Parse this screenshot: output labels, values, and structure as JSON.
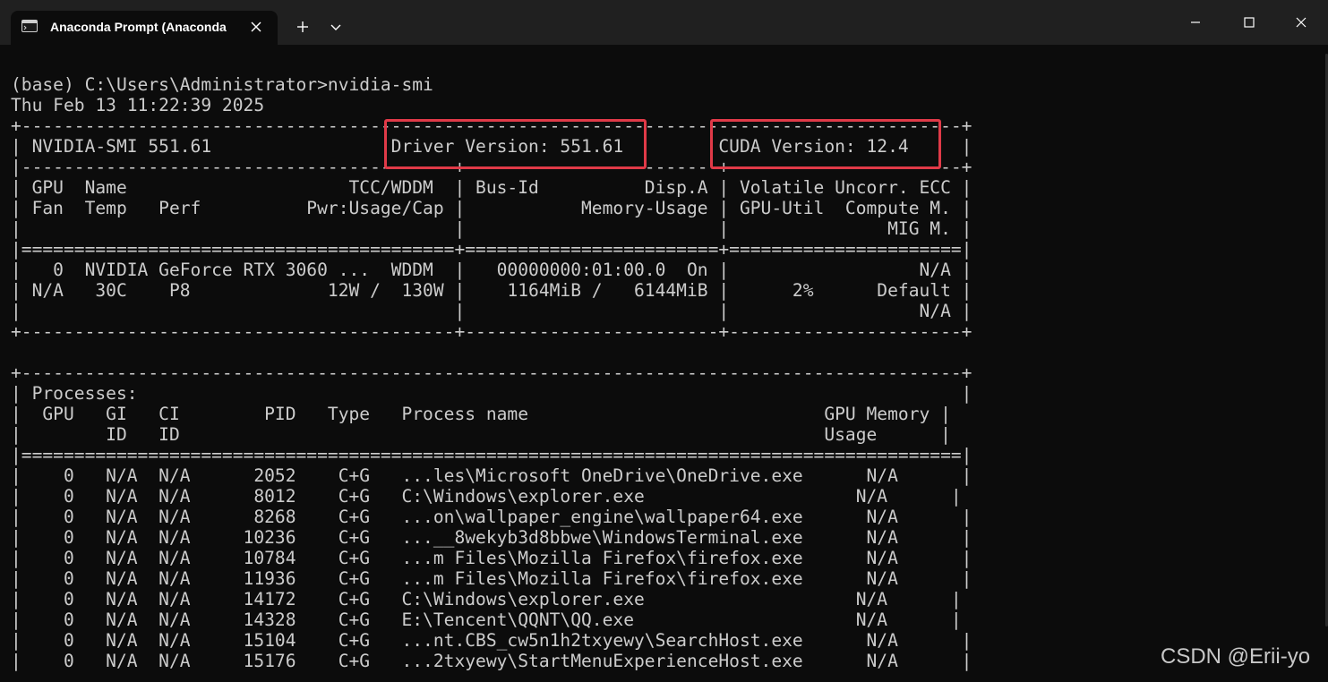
{
  "window": {
    "tab_title": "Anaconda Prompt (Anaconda",
    "tab_icon": "terminal-icon",
    "controls": [
      "minimize",
      "maximize",
      "close"
    ]
  },
  "colors": {
    "background": "#0c0c0c",
    "titlebar": "#202020",
    "text": "#cccccc",
    "highlight": "#e03a48"
  },
  "terminal": {
    "lines": [
      "(base) C:\\Users\\Administrator>nvidia-smi",
      "Thu Feb 13 11:22:39 2025",
      "+-----------------------------------------------------------------------------------------+",
      "| NVIDIA-SMI 551.61                 Driver Version: 551.61         CUDA Version: 12.4     |",
      "|-----------------------------------------+------------------------+----------------------+",
      "| GPU  Name                     TCC/WDDM  | Bus-Id          Disp.A | Volatile Uncorr. ECC |",
      "| Fan  Temp   Perf          Pwr:Usage/Cap |           Memory-Usage | GPU-Util  Compute M. |",
      "|                                         |                        |               MIG M. |",
      "|=========================================+========================+======================|",
      "|   0  NVIDIA GeForce RTX 3060 ...  WDDM  |   00000000:01:00.0  On |                  N/A |",
      "| N/A   30C    P8             12W /  130W |    1164MiB /   6144MiB |      2%      Default |",
      "|                                         |                        |                  N/A |",
      "+-----------------------------------------+------------------------+----------------------+",
      "",
      "+-----------------------------------------------------------------------------------------+",
      "| Processes:                                                                              |",
      "|  GPU   GI   CI        PID   Type   Process name                            GPU Memory |",
      "|        ID   ID                                                             Usage      |",
      "|=========================================================================================|",
      "|    0   N/A  N/A      2052    C+G   ...les\\Microsoft OneDrive\\OneDrive.exe      N/A      |",
      "|    0   N/A  N/A      8012    C+G   C:\\Windows\\explorer.exe                    N/A      |",
      "|    0   N/A  N/A      8268    C+G   ...on\\wallpaper_engine\\wallpaper64.exe      N/A      |",
      "|    0   N/A  N/A     10236    C+G   ...__8wekyb3d8bbwe\\WindowsTerminal.exe      N/A      |",
      "|    0   N/A  N/A     10784    C+G   ...m Files\\Mozilla Firefox\\firefox.exe      N/A      |",
      "|    0   N/A  N/A     11936    C+G   ...m Files\\Mozilla Firefox\\firefox.exe      N/A      |",
      "|    0   N/A  N/A     14172    C+G   C:\\Windows\\explorer.exe                    N/A      |",
      "|    0   N/A  N/A     14328    C+G   E:\\Tencent\\QQNT\\QQ.exe                     N/A      |",
      "|    0   N/A  N/A     15104    C+G   ...nt.CBS_cw5n1h2txyewy\\SearchHost.exe      N/A      |",
      "|    0   N/A  N/A     15176    C+G   ...2txyewy\\StartMenuExperienceHost.exe      N/A      |"
    ]
  },
  "watermark": "CSDN @Erii-yo"
}
